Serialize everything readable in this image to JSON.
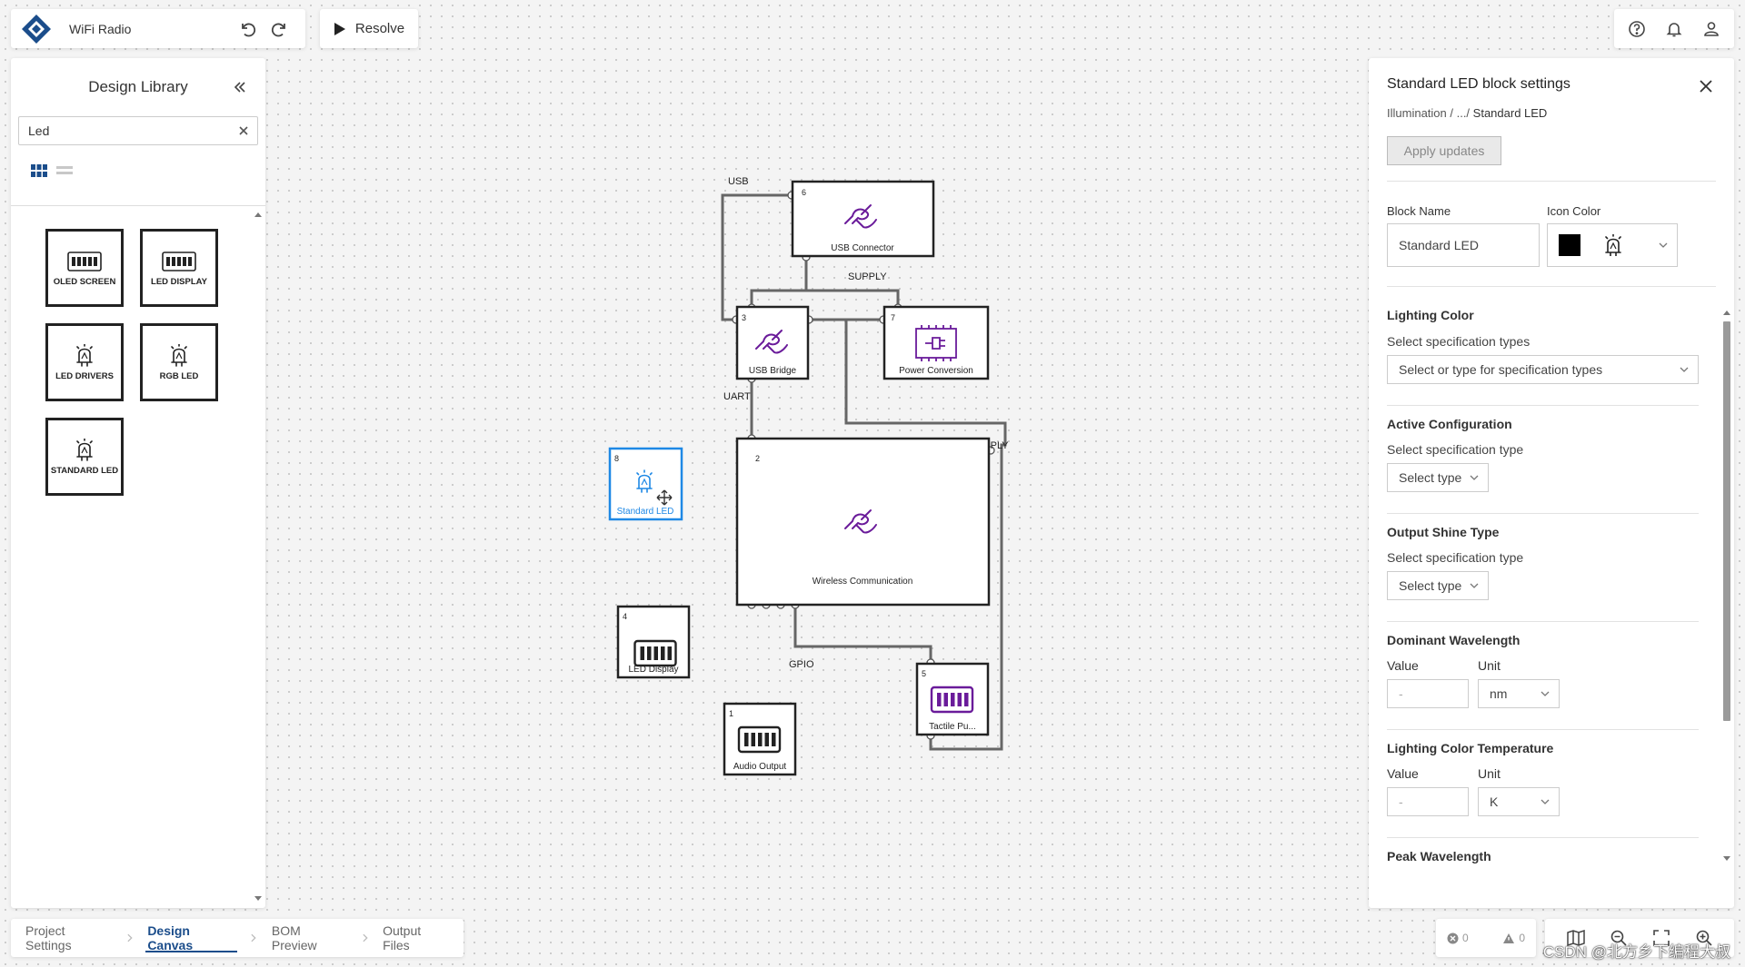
{
  "app": {
    "title": "WiFi Radio",
    "resolve_label": "Resolve"
  },
  "icons": {
    "logo": "diamond-logo-icon",
    "undo": "undo-icon",
    "redo": "redo-icon",
    "play": "play-icon",
    "help": "help-icon",
    "bell": "bell-icon",
    "user": "user-icon"
  },
  "colors": {
    "accent": "#1b4d8b",
    "block_icon": "#6a1b9a",
    "selected": "#1e88e5"
  },
  "library": {
    "title": "Design Library",
    "search_value": "Led",
    "items": [
      {
        "label": "OLED SCREEN",
        "icon": "display-chip-icon"
      },
      {
        "label": "LED DISPLAY",
        "icon": "display-chip-icon"
      },
      {
        "label": "LED DRIVERS",
        "icon": "led-icon"
      },
      {
        "label": "RGB LED",
        "icon": "led-icon"
      },
      {
        "label": "STANDARD LED",
        "icon": "led-icon"
      }
    ]
  },
  "canvas": {
    "blocks": {
      "usb_connector": {
        "num": "6",
        "label": "USB Connector"
      },
      "usb_bridge": {
        "num": "3",
        "label": "USB Bridge"
      },
      "power_conversion": {
        "num": "7",
        "label": "Power Conversion"
      },
      "standard_led": {
        "num": "8",
        "label": "Standard LED"
      },
      "wireless": {
        "num": "2",
        "label": "Wireless Communication"
      },
      "led_display": {
        "num": "4",
        "label": "LED Display"
      },
      "tactile": {
        "num": "5",
        "label": "Tactile Pu..."
      },
      "audio_output": {
        "num": "1",
        "label": "Audio Output"
      }
    },
    "nets": {
      "usb": "USB",
      "supply1": "SUPPLY",
      "uart": "UART",
      "supply2": "SUPPLY",
      "gpio": "GPIO"
    }
  },
  "settings": {
    "title": "Standard LED block settings",
    "breadcrumb_prefix": "Illumination / .../",
    "breadcrumb_current": " Standard LED",
    "apply_label": "Apply updates",
    "block_name_label": "Block Name",
    "block_name_value": "Standard LED",
    "icon_color_label": "Icon Color",
    "icon_color_value": "#000000",
    "lighting_color": {
      "title": "Lighting Color",
      "sub": "Select specification types",
      "placeholder": "Select or type for specification types"
    },
    "active_config": {
      "title": "Active Configuration",
      "sub": "Select specification type",
      "select": "Select type"
    },
    "output_shine": {
      "title": "Output Shine Type",
      "sub": "Select specification type",
      "select": "Select type"
    },
    "dominant_wavelength": {
      "title": "Dominant Wavelength",
      "value_label": "Value",
      "value": "-",
      "unit_label": "Unit",
      "unit": "nm"
    },
    "color_temperature": {
      "title": "Lighting Color Temperature",
      "value_label": "Value",
      "value": "-",
      "unit_label": "Unit",
      "unit": "K"
    },
    "peak_wavelength": {
      "title": "Peak Wavelength"
    }
  },
  "tabs": [
    "Project Settings",
    "Design Canvas",
    "BOM Preview",
    "Output Files"
  ],
  "counters": {
    "errors": "0",
    "warnings": "0"
  },
  "watermark": "CSDN @北方乡下编程大叔"
}
